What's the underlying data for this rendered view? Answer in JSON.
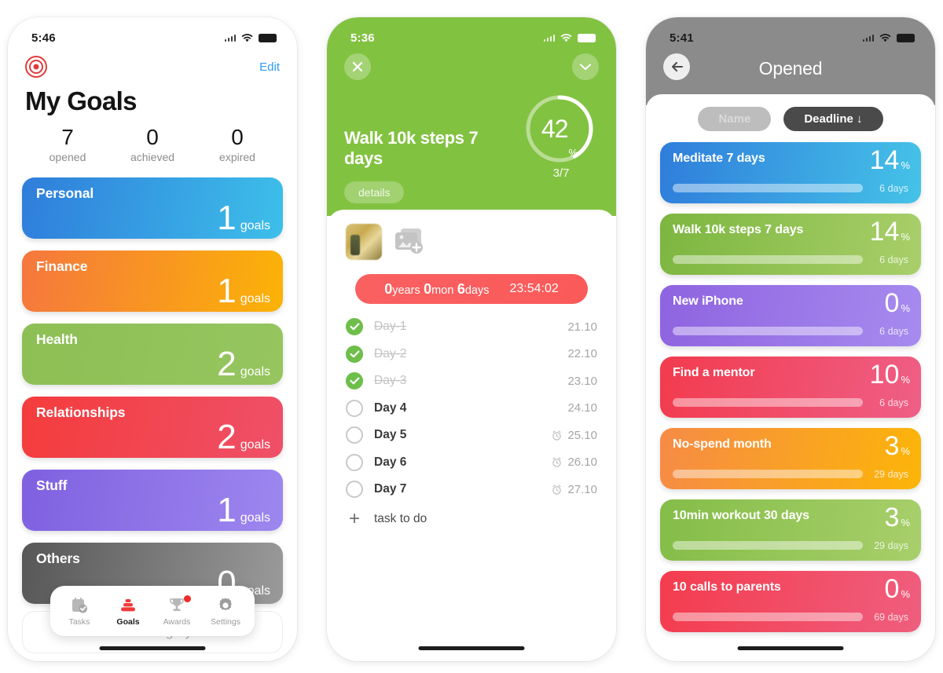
{
  "phone1": {
    "status": {
      "time": "5:46",
      "wifi_icon": "wifi-icon",
      "battery_icon": "battery-icon"
    },
    "logo_icon": "target-icon",
    "edit_label": "Edit",
    "title": "My Goals",
    "stats": [
      {
        "value": "7",
        "label": "opened"
      },
      {
        "value": "0",
        "label": "achieved"
      },
      {
        "value": "0",
        "label": "expired"
      }
    ],
    "categories": [
      {
        "name": "Personal",
        "count": "1",
        "unit": "goals",
        "from": "#2f7ddb",
        "to": "#3dbfe9"
      },
      {
        "name": "Finance",
        "count": "1",
        "unit": "goals",
        "from": "#f5773e",
        "to": "#fbb306"
      },
      {
        "name": "Health",
        "count": "2",
        "unit": "goals",
        "from": "#8dbf55",
        "to": "#96c55f"
      },
      {
        "name": "Relationships",
        "count": "2",
        "unit": "goals",
        "from": "#f43c3c",
        "to": "#ef5068"
      },
      {
        "name": "Stuff",
        "count": "1",
        "unit": "goals",
        "from": "#7f60e0",
        "to": "#9d87ef"
      },
      {
        "name": "Others",
        "count": "0",
        "unit": "goals",
        "from": "#575757",
        "to": "#9a9a9a"
      }
    ],
    "add_category_label": "Add category",
    "tabs": [
      {
        "label": "Tasks",
        "icon": "tasks-icon",
        "active": false,
        "badge": false
      },
      {
        "label": "Goals",
        "icon": "goals-icon",
        "active": true,
        "badge": false
      },
      {
        "label": "Awards",
        "icon": "trophy-icon",
        "active": false,
        "badge": true
      },
      {
        "label": "Settings",
        "icon": "gear-icon",
        "active": false,
        "badge": false
      }
    ]
  },
  "phone2": {
    "status": {
      "time": "5:36",
      "wifi_icon": "wifi-icon",
      "battery_icon": "battery-icon"
    },
    "close_icon": "close-icon",
    "collapse_icon": "chevron-down-icon",
    "goal_title": "Walk 10k steps 7 days",
    "details_label": "details",
    "progress": {
      "percent": "42",
      "percent_symbol": "%",
      "fraction": "3/7",
      "value": 42
    },
    "photo_thumb": "photo-thumbnail",
    "add_photo_icon": "add-photo-icon",
    "countdown": {
      "years": "0",
      "years_label": "years",
      "months": "0",
      "months_label": "mon",
      "days": "6",
      "days_label": "days",
      "timer": "23:54:02"
    },
    "days": [
      {
        "label": "Day-1",
        "date": "21.10",
        "done": true,
        "alarm": false
      },
      {
        "label": "Day-2",
        "date": "22.10",
        "done": true,
        "alarm": false
      },
      {
        "label": "Day-3",
        "date": "23.10",
        "done": true,
        "alarm": false
      },
      {
        "label": "Day 4",
        "date": "24.10",
        "done": false,
        "alarm": false
      },
      {
        "label": "Day 5",
        "date": "25.10",
        "done": false,
        "alarm": true
      },
      {
        "label": "Day 6",
        "date": "26.10",
        "done": false,
        "alarm": true
      },
      {
        "label": "Day 7",
        "date": "27.10",
        "done": false,
        "alarm": true
      }
    ],
    "add_task_label": "task to do"
  },
  "phone3": {
    "status": {
      "time": "5:41",
      "wifi_icon": "wifi-icon",
      "battery_icon": "battery-icon"
    },
    "back_icon": "back-arrow-icon",
    "title": "Opened",
    "sort": {
      "name_label": "Name",
      "deadline_label": "Deadline ↓"
    },
    "goals": [
      {
        "name": "Meditate 7 days",
        "pct": "14",
        "sym": "%",
        "days": "6 days",
        "fill": 14,
        "from": "#2f7ddb",
        "to": "#45c3e8"
      },
      {
        "name": "Walk 10k steps 7 days",
        "pct": "14",
        "sym": "%",
        "days": "6 days",
        "fill": 14,
        "from": "#7cb63f",
        "to": "#a9cf6a"
      },
      {
        "name": "New iPhone",
        "pct": "0",
        "sym": "%",
        "days": "6 days",
        "fill": 0,
        "from": "#8e63e0",
        "to": "#a78bef"
      },
      {
        "name": "Find a mentor",
        "pct": "10",
        "sym": "%",
        "days": "6 days",
        "fill": 10,
        "from": "#f23b4e",
        "to": "#ef5f86"
      },
      {
        "name": "No-spend month",
        "pct": "3",
        "sym": "%",
        "days": "29 days",
        "fill": 3,
        "from": "#f68b46",
        "to": "#fcb508"
      },
      {
        "name": "10min workout 30 days",
        "pct": "3",
        "sym": "%",
        "days": "29 days",
        "fill": 3,
        "from": "#84bd48",
        "to": "#a8cf6b"
      },
      {
        "name": "10 calls to parents",
        "pct": "0",
        "sym": "%",
        "days": "69 days",
        "fill": 0,
        "from": "#f43c4e",
        "to": "#ef5e7e"
      }
    ]
  }
}
